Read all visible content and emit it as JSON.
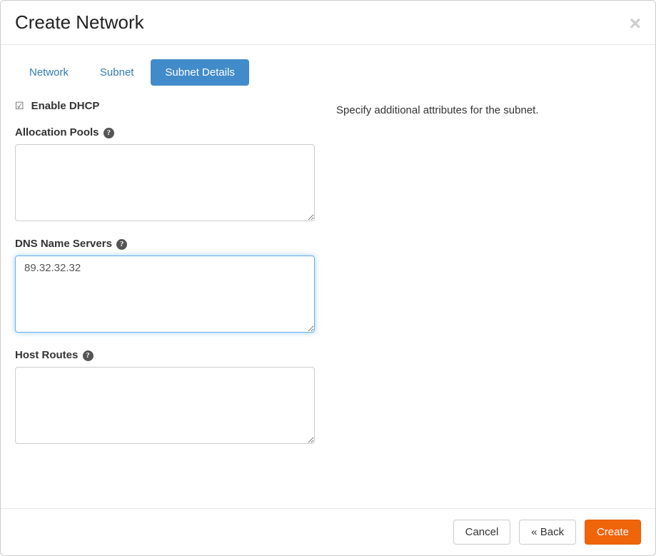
{
  "modal": {
    "title": "Create Network"
  },
  "tabs": {
    "network": "Network",
    "subnet": "Subnet",
    "subnet_details": "Subnet Details"
  },
  "form": {
    "enable_dhcp_label": "Enable DHCP",
    "allocation_pools_label": "Allocation Pools",
    "allocation_pools_value": "",
    "dns_name_servers_label": "DNS Name Servers",
    "dns_name_servers_value": "89.32.32.32",
    "host_routes_label": "Host Routes",
    "host_routes_value": ""
  },
  "help": {
    "description": "Specify additional attributes for the subnet."
  },
  "footer": {
    "cancel": "Cancel",
    "back": "« Back",
    "create": "Create"
  }
}
